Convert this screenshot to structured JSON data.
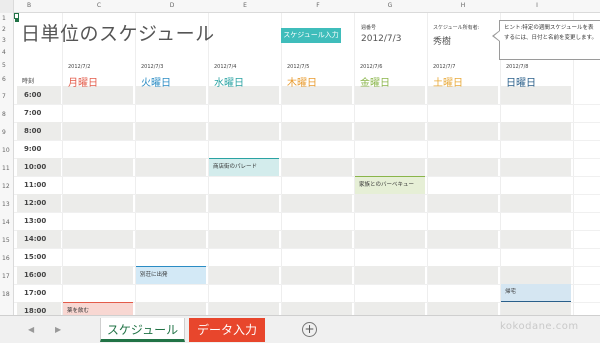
{
  "sheet": {
    "columns": [
      "B",
      "C",
      "D",
      "E",
      "F",
      "G",
      "H",
      "I"
    ],
    "rows": [
      "1",
      "2",
      "3",
      "4",
      "5",
      "6",
      "7",
      "8",
      "9",
      "10",
      "11",
      "12",
      "13",
      "14",
      "15",
      "16",
      "17",
      "18"
    ]
  },
  "header": {
    "title": "日単位のスケジュール",
    "schedule_button": "スケジュール入力 〉",
    "week_start_label": "週番号",
    "week_start_value": "2012/7/3",
    "owner_label": "スケジュール所有者:",
    "owner_value": "秀樹",
    "hint_line1": "ヒント:特定の週間スケジュールを表",
    "hint_line2": "するには、日付と名前を変更します。"
  },
  "time_header": "時刻",
  "days": [
    {
      "date": "2012/7/2",
      "name": "月曜日",
      "color": "#e35b4a"
    },
    {
      "date": "2012/7/3",
      "name": "火曜日",
      "color": "#2b8cc4"
    },
    {
      "date": "2012/7/4",
      "name": "水曜日",
      "color": "#2aa3a3"
    },
    {
      "date": "2012/7/5",
      "name": "木曜日",
      "color": "#e89b2f"
    },
    {
      "date": "2012/7/6",
      "name": "金曜日",
      "color": "#8ab54a"
    },
    {
      "date": "2012/7/7",
      "name": "土曜日",
      "color": "#e8a93a"
    },
    {
      "date": "2012/7/8",
      "name": "日曜日",
      "color": "#2a5f8a"
    }
  ],
  "times": [
    "6:00",
    "7:00",
    "8:00",
    "9:00",
    "10:00",
    "11:00",
    "12:00",
    "13:00",
    "14:00",
    "15:00",
    "16:00",
    "17:00",
    "18:00"
  ],
  "events": [
    {
      "day": 2,
      "time": "10:00",
      "label": "商店街のパレード",
      "style": "teal"
    },
    {
      "day": 4,
      "time": "11:00",
      "label": "家族とのバーベキュー",
      "style": "green"
    },
    {
      "day": 1,
      "time": "16:00",
      "label": "別荘に出発",
      "style": "blue"
    },
    {
      "day": 6,
      "time": "17:00",
      "label": "帰宅",
      "style": "blue2"
    },
    {
      "day": 0,
      "time": "18:00",
      "label": "薬を飲む",
      "style": "red"
    }
  ],
  "tabs": {
    "schedule": "スケジュール",
    "data_entry": "データ入力",
    "add_sheet": "+"
  },
  "watermark": "kokodane.com"
}
